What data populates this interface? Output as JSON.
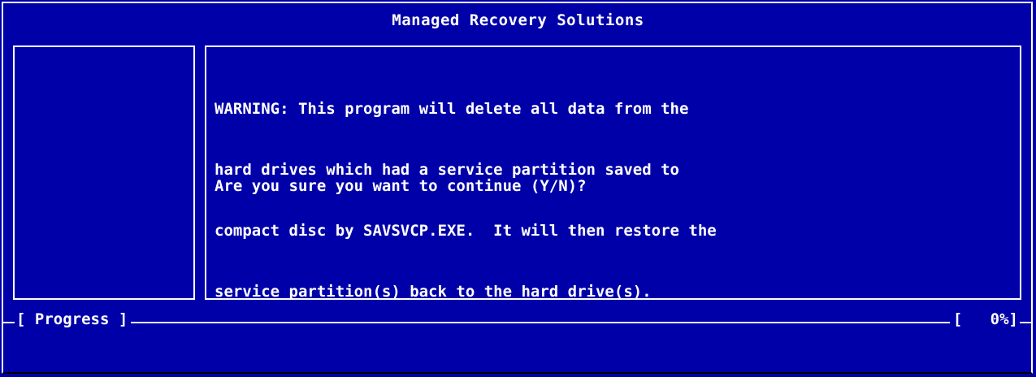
{
  "window": {
    "title": "Managed Recovery Solutions"
  },
  "message": {
    "lines": [
      "WARNING: This program will delete all data from the",
      "hard drives which had a service partition saved to",
      "compact disc by SAVSVCP.EXE.  It will then restore the",
      "service partition(s) back to the hard drive(s)."
    ],
    "prompt": "Are you sure you want to continue (Y/N)?"
  },
  "progress": {
    "label": "[ Progress ]",
    "percent_text": "[   0%]",
    "percent": 0
  },
  "colors": {
    "background": "#0000a8",
    "foreground": "#ffffff"
  }
}
